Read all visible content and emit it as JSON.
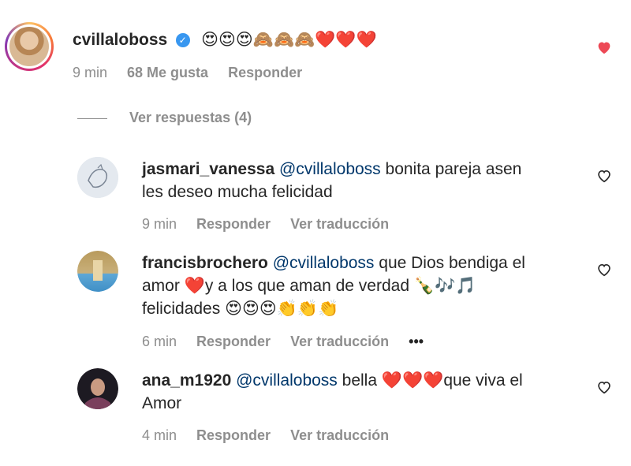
{
  "main_comment": {
    "username": "cvillaloboss",
    "verified_label": "✓",
    "emojis": "😍😍😍🙈🙈🙈❤️❤️❤️",
    "time": "9 min",
    "likes": "68 Me gusta",
    "reply_label": "Responder",
    "liked": true
  },
  "view_replies": {
    "label": "Ver respuestas (4)"
  },
  "replies": [
    {
      "username": "jasmari_vanessa",
      "mention": "@cvillaloboss",
      "text_line1": " bonita pareja asen",
      "text_line2": "les deseo mucha felicidad",
      "time": "9 min",
      "reply_label": "Responder",
      "translate_label": "Ver traducción"
    },
    {
      "username": "francisbrochero",
      "mention": "@cvillaloboss",
      "text_line1": " que Dios bendiga el",
      "text_line2a": "amor ",
      "emoji_heart": "❤️",
      "text_line2b": "y a los que aman de verdad ",
      "emoji_music": "🍾🎶🎵",
      "text_line3": "felicidades ",
      "emoji_end": "😍😍😍👏👏👏",
      "time": "6 min",
      "reply_label": "Responder",
      "translate_label": "Ver traducción",
      "more_label": "•••"
    },
    {
      "username": "ana_m1920",
      "mention": "@cvillaloboss",
      "text_line1a": " bella ",
      "emoji_hearts": "❤️❤️❤️",
      "text_line1b": "que viva el",
      "text_line2": "Amor",
      "time": "4 min",
      "reply_label": "Responder",
      "translate_label": "Ver traducción"
    }
  ],
  "colors": {
    "like_red": "#ed4956",
    "mention_blue": "#00376b",
    "meta_gray": "#8e8e8e"
  }
}
